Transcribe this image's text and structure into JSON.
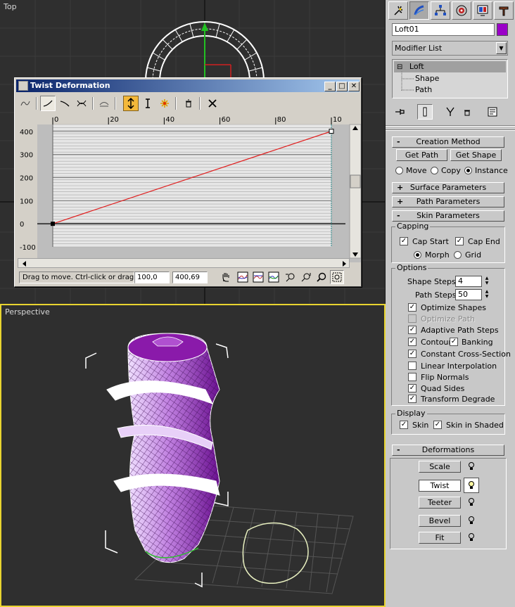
{
  "viewports": {
    "top_label": "Top",
    "perspective_label": "Perspective"
  },
  "twist_dialog": {
    "title": "Twist Deformation",
    "x_ticks": [
      "0",
      "20",
      "40",
      "60",
      "80",
      "10"
    ],
    "y_ticks": [
      "400",
      "300",
      "200",
      "100",
      "0",
      "-100"
    ],
    "status_text": "Drag to move. Ctrl-click or drag re",
    "x_value": "100,0",
    "y_value": "400,69",
    "curve": {
      "x": [
        0,
        100
      ],
      "y": [
        0,
        400.69
      ]
    },
    "curve_color": "#e02020",
    "minimize_label": "_",
    "maximize_label": "□",
    "close_label": "✕"
  },
  "panel": {
    "object_name": "Loft01",
    "object_color": "#9a00c8",
    "modifier_list": "Modifier List",
    "stack": {
      "root": "Loft",
      "toggle": "⊟",
      "items": [
        "Shape",
        "Path"
      ]
    },
    "creation_method": {
      "header": "Creation Method",
      "sign": "-",
      "get_path": "Get Path",
      "get_shape": "Get Shape",
      "move": "Move",
      "copy": "Copy",
      "instance": "Instance",
      "selected": "instance"
    },
    "surface_parameters": {
      "header": "Surface Parameters",
      "sign": "+"
    },
    "path_parameters": {
      "header": "Path Parameters",
      "sign": "+"
    },
    "skin_parameters": {
      "header": "Skin Parameters",
      "sign": "-",
      "capping": {
        "title": "Capping",
        "cap_start": "Cap Start",
        "cap_end": "Cap End",
        "morph": "Morph",
        "grid": "Grid",
        "cap_start_checked": true,
        "cap_end_checked": true,
        "selected": "morph"
      },
      "options": {
        "title": "Options",
        "shape_steps_label": "Shape Steps:",
        "shape_steps": "4",
        "path_steps_label": "Path Steps:",
        "path_steps": "50",
        "optimize_shapes": {
          "label": "Optimize Shapes",
          "checked": true
        },
        "optimize_path": {
          "label": "Optimize Path",
          "checked": false,
          "disabled": true
        },
        "adaptive_path_steps": {
          "label": "Adaptive Path Steps",
          "checked": true
        },
        "contour": {
          "label": "Contour",
          "checked": true
        },
        "banking": {
          "label": "Banking",
          "checked": true
        },
        "constant_cross_section": {
          "label": "Constant Cross-Section",
          "checked": true
        },
        "linear_interpolation": {
          "label": "Linear Interpolation",
          "checked": false
        },
        "flip_normals": {
          "label": "Flip Normals",
          "checked": false
        },
        "quad_sides": {
          "label": "Quad Sides",
          "checked": true
        },
        "transform_degrade": {
          "label": "Transform Degrade",
          "checked": true
        }
      },
      "display": {
        "title": "Display",
        "skin": {
          "label": "Skin",
          "checked": true
        },
        "skin_in_shaded": {
          "label": "Skin in Shaded",
          "checked": true
        }
      }
    },
    "deformations": {
      "header": "Deformations",
      "sign": "-",
      "scale": "Scale",
      "twist": "Twist",
      "teeter": "Teeter",
      "bevel": "Bevel",
      "fit": "Fit"
    }
  },
  "check_mark": "✓"
}
